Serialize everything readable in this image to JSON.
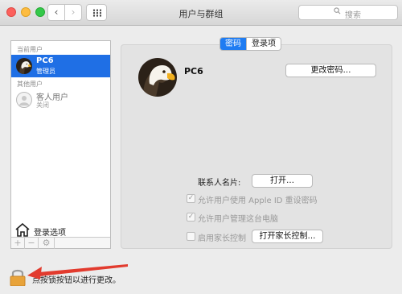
{
  "window": {
    "title": "用户与群组"
  },
  "search": {
    "placeholder": "搜索"
  },
  "nav": {
    "back": "‹",
    "forward": "›"
  },
  "sidebar": {
    "current_users_label": "当前用户",
    "current_user": {
      "name": "PC6",
      "role": "管理员"
    },
    "other_users_label": "其他用户",
    "guest_user": {
      "name": "客人用户",
      "status": "关闭"
    },
    "login_options_label": "登录选项",
    "toolbar": {
      "add": "+",
      "remove": "−",
      "gear": "⚙"
    }
  },
  "tabs": [
    {
      "label": "密码",
      "active": true
    },
    {
      "label": "登录项",
      "active": false
    }
  ],
  "main": {
    "user_name": "PC6",
    "change_password_button": "更改密码…",
    "contact_card_label": "联系人名片:",
    "open_button": "打开…",
    "allow_apple_id_reset": "允许用户使用 Apple ID 重设密码",
    "allow_admin": "允许用户管理这台电脑",
    "enable_parental": "启用家长控制",
    "open_parental_button": "打开家长控制…",
    "allow_apple_id_checked": true,
    "allow_admin_checked": true,
    "parental_checked": false
  },
  "footer": {
    "lock_text": "点按锁按钮以进行更改。"
  },
  "colors": {
    "selection": "#1f6fe5",
    "arrow": "#e23b2e",
    "lock": "#e8a33a"
  }
}
